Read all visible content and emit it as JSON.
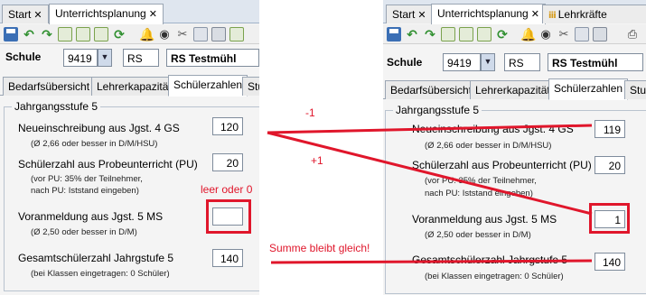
{
  "left": {
    "tabs": [
      {
        "label": "Start"
      },
      {
        "label": "Unterrichtsplanung"
      }
    ],
    "school": {
      "label": "Schule",
      "number": "9419",
      "type": "RS",
      "name": "RS Testmühl"
    },
    "subtabs": [
      {
        "label": "Bedarfsübersicht"
      },
      {
        "label": "Lehrerkapazität"
      },
      {
        "label": "Schülerzahlen"
      },
      {
        "label": "Stu"
      }
    ],
    "group_title": "Jahrgangsstufe 5",
    "rows": [
      {
        "label": "Neueinschreibung aus Jgst. 4 GS",
        "sub": "(Ø 2,66 oder besser in D/M/HSU)",
        "value": "120"
      },
      {
        "label": "Schülerzahl aus Probeunterricht (PU)",
        "sub": "(vor PU: 35% der Teilnehmer,",
        "sub2": "nach PU: Iststand eingeben)",
        "value": "20"
      },
      {
        "label": "Voranmeldung aus Jgst. 5 MS",
        "sub": "(Ø 2,50 oder besser in D/M)",
        "value": ""
      },
      {
        "label": "Gesamtschülerzahl Jahrgstufe 5",
        "sub": "(bei Klassen eingetragen: 0 Schüler)",
        "value": "140"
      }
    ]
  },
  "right": {
    "tabs": [
      {
        "label": "Start"
      },
      {
        "label": "Unterrichtsplanung"
      },
      {
        "label": "Lehrkräfte"
      }
    ],
    "school": {
      "label": "Schule",
      "number": "9419",
      "type": "RS",
      "name": "RS Testmühl"
    },
    "subtabs": [
      {
        "label": "Bedarfsübersicht"
      },
      {
        "label": "Lehrerkapazität"
      },
      {
        "label": "Schülerzahlen"
      },
      {
        "label": "Stu"
      }
    ],
    "group_title": "Jahrgangsstufe 5",
    "rows": [
      {
        "label": "Neueinschreibung aus Jgst. 4 GS",
        "sub": "(Ø 2,66 oder besser in D/M/HSU)",
        "value": "119"
      },
      {
        "label": "Schülerzahl aus Probeunterricht (PU)",
        "sub": "(vor PU: 35% der Teilnehmer,",
        "sub2": "nach PU: Iststand eingeben)",
        "value": "20"
      },
      {
        "label": "Voranmeldung aus Jgst. 5 MS",
        "sub": "(Ø 2,50 oder besser in D/M)",
        "value": "1"
      },
      {
        "label": "Gesamtschülerzahl Jahrgstufe 5",
        "sub": "(bei Klassen eingetragen: 0 Schüler)",
        "value": "140"
      }
    ]
  },
  "annotations": {
    "minus": "-1",
    "plus": "+1",
    "empty_hint": "leer oder 0",
    "sum_hint": "Summe bleibt gleich!"
  },
  "colors": {
    "annotation": "#e0162b",
    "tab_strip": "#dfe6ef",
    "panel": "#f4f4f4"
  },
  "icons": {
    "tab_close": "close-icon",
    "toolbar": [
      "save-icon",
      "undo-icon",
      "redo-icon",
      "document-icon",
      "refresh-icon",
      "bell-icon",
      "eye-icon",
      "scissors-icon",
      "copy-icon",
      "paste-icon",
      "print-icon"
    ],
    "dropdown": "chevron-down-icon",
    "tab_people": "people-icon"
  }
}
